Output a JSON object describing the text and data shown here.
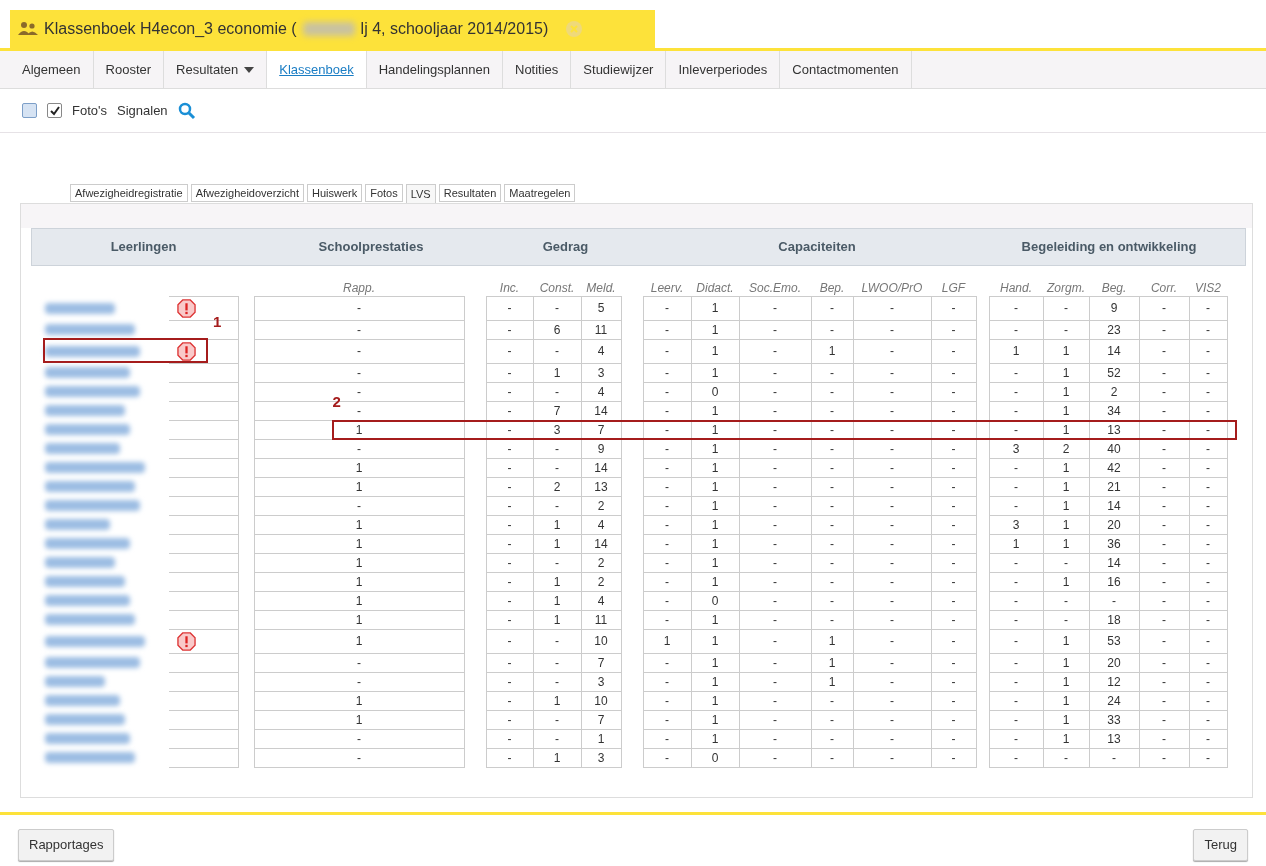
{
  "window": {
    "title_start": "Klassenboek H4econ_3 economie (",
    "title_end": "lj 4, schooljaar 2014/2015)"
  },
  "nav_tabs": [
    {
      "label": "Algemeen",
      "selected": false,
      "dropdown": false
    },
    {
      "label": "Rooster",
      "selected": false,
      "dropdown": false
    },
    {
      "label": "Resultaten",
      "selected": false,
      "dropdown": true
    },
    {
      "label": "Klassenboek",
      "selected": true,
      "dropdown": false
    },
    {
      "label": "Handelingsplannen",
      "selected": false,
      "dropdown": false
    },
    {
      "label": "Notities",
      "selected": false,
      "dropdown": false
    },
    {
      "label": "Studiewijzer",
      "selected": false,
      "dropdown": false
    },
    {
      "label": "Inleverperiodes",
      "selected": false,
      "dropdown": false
    },
    {
      "label": "Contactmomenten",
      "selected": false,
      "dropdown": false
    }
  ],
  "toolbar": {
    "checkboxes": [
      {
        "checked": false
      },
      {
        "checked": true
      }
    ],
    "labels": [
      "Foto's",
      "Signalen"
    ]
  },
  "sub_tabs": [
    {
      "label": "Afwezigheidregistratie",
      "selected": false
    },
    {
      "label": "Afwezigheidoverzicht",
      "selected": false
    },
    {
      "label": "Huiswerk",
      "selected": false
    },
    {
      "label": "Fotos",
      "selected": false
    },
    {
      "label": "LVS",
      "selected": true
    },
    {
      "label": "Resultaten",
      "selected": false
    },
    {
      "label": "Maatregelen",
      "selected": false
    }
  ],
  "table": {
    "groups": [
      "Leerlingen",
      "Schoolprestaties",
      "Gedrag",
      "Capaciteiten",
      "Begeleiding en ontwikkeling"
    ],
    "columns": [
      "Rapp.",
      "Inc.",
      "Const.",
      "Meld.",
      "Leerv.",
      "Didact.",
      "Soc.Emo.",
      "Bep.",
      "LWOO/PrO",
      "LGF",
      "Hand.",
      "Zorgm.",
      "Beg.",
      "Corr.",
      "VIS2"
    ],
    "rows": [
      {
        "alert": true,
        "cells": [
          "-",
          "-",
          "-",
          "5",
          "-",
          "1",
          "-",
          "-",
          "-",
          "-",
          "-",
          "-",
          "9",
          "-",
          "-"
        ]
      },
      {
        "alert": false,
        "cells": [
          "-",
          "-",
          "6",
          "11",
          "-",
          "1",
          "-",
          "-",
          "-",
          "-",
          "-",
          "-",
          "23",
          "-",
          "-"
        ]
      },
      {
        "alert": true,
        "name_annotation": "1",
        "cells": [
          "-",
          "-",
          "-",
          "4",
          "-",
          "1",
          "-",
          "1",
          "-",
          "-",
          "1",
          "1",
          "14",
          "-",
          "-"
        ]
      },
      {
        "alert": false,
        "cells": [
          "-",
          "-",
          "1",
          "3",
          "-",
          "1",
          "-",
          "-",
          "-",
          "-",
          "-",
          "1",
          "52",
          "-",
          "-"
        ]
      },
      {
        "alert": false,
        "cells": [
          "-",
          "-",
          "-",
          "4",
          "-",
          "0",
          "-",
          "-",
          "-",
          "-",
          "-",
          "1",
          "2",
          "-",
          "-"
        ]
      },
      {
        "alert": false,
        "cells": [
          "-",
          "-",
          "7",
          "14",
          "-",
          "1",
          "-",
          "-",
          "-",
          "-",
          "-",
          "1",
          "34",
          "-",
          "-"
        ]
      },
      {
        "alert": false,
        "data_annotation": "2",
        "cells": [
          "1",
          "-",
          "3",
          "7",
          "-",
          "1",
          "-",
          "-",
          "-",
          "-",
          "-",
          "1",
          "13",
          "-",
          "-"
        ]
      },
      {
        "alert": false,
        "cells": [
          "-",
          "-",
          "-",
          "9",
          "-",
          "1",
          "-",
          "-",
          "-",
          "-",
          "3",
          "2",
          "40",
          "-",
          "-"
        ]
      },
      {
        "alert": false,
        "cells": [
          "1",
          "-",
          "-",
          "14",
          "-",
          "1",
          "-",
          "-",
          "-",
          "-",
          "-",
          "1",
          "42",
          "-",
          "-"
        ]
      },
      {
        "alert": false,
        "cells": [
          "1",
          "-",
          "2",
          "13",
          "-",
          "1",
          "-",
          "-",
          "-",
          "-",
          "-",
          "1",
          "21",
          "-",
          "-"
        ]
      },
      {
        "alert": false,
        "cells": [
          "-",
          "-",
          "-",
          "2",
          "-",
          "1",
          "-",
          "-",
          "-",
          "-",
          "-",
          "1",
          "14",
          "-",
          "-"
        ]
      },
      {
        "alert": false,
        "cells": [
          "1",
          "-",
          "1",
          "4",
          "-",
          "1",
          "-",
          "-",
          "-",
          "-",
          "3",
          "1",
          "20",
          "-",
          "-"
        ]
      },
      {
        "alert": false,
        "cells": [
          "1",
          "-",
          "1",
          "14",
          "-",
          "1",
          "-",
          "-",
          "-",
          "-",
          "1",
          "1",
          "36",
          "-",
          "-"
        ]
      },
      {
        "alert": false,
        "cells": [
          "1",
          "-",
          "-",
          "2",
          "-",
          "1",
          "-",
          "-",
          "-",
          "-",
          "-",
          "-",
          "14",
          "-",
          "-"
        ]
      },
      {
        "alert": false,
        "cells": [
          "1",
          "-",
          "1",
          "2",
          "-",
          "1",
          "-",
          "-",
          "-",
          "-",
          "-",
          "1",
          "16",
          "-",
          "-"
        ]
      },
      {
        "alert": false,
        "cells": [
          "1",
          "-",
          "1",
          "4",
          "-",
          "0",
          "-",
          "-",
          "-",
          "-",
          "-",
          "-",
          "-",
          "-",
          "-"
        ]
      },
      {
        "alert": false,
        "cells": [
          "1",
          "-",
          "1",
          "11",
          "-",
          "1",
          "-",
          "-",
          "-",
          "-",
          "-",
          "-",
          "18",
          "-",
          "-"
        ]
      },
      {
        "alert": true,
        "cells": [
          "1",
          "-",
          "-",
          "10",
          "1",
          "1",
          "-",
          "1",
          "-",
          "-",
          "-",
          "1",
          "53",
          "-",
          "-"
        ]
      },
      {
        "alert": false,
        "cells": [
          "-",
          "-",
          "-",
          "7",
          "-",
          "1",
          "-",
          "1",
          "-",
          "-",
          "-",
          "1",
          "20",
          "-",
          "-"
        ]
      },
      {
        "alert": false,
        "cells": [
          "-",
          "-",
          "-",
          "3",
          "-",
          "1",
          "-",
          "1",
          "-",
          "-",
          "-",
          "1",
          "12",
          "-",
          "-"
        ]
      },
      {
        "alert": false,
        "cells": [
          "1",
          "-",
          "1",
          "10",
          "-",
          "1",
          "-",
          "-",
          "-",
          "-",
          "-",
          "1",
          "24",
          "-",
          "-"
        ]
      },
      {
        "alert": false,
        "cells": [
          "1",
          "-",
          "-",
          "7",
          "-",
          "1",
          "-",
          "-",
          "-",
          "-",
          "-",
          "1",
          "33",
          "-",
          "-"
        ]
      },
      {
        "alert": false,
        "cells": [
          "-",
          "-",
          "-",
          "1",
          "-",
          "1",
          "-",
          "-",
          "-",
          "-",
          "-",
          "1",
          "13",
          "-",
          "-"
        ]
      },
      {
        "alert": false,
        "cells": [
          "-",
          "-",
          "1",
          "3",
          "-",
          "0",
          "-",
          "-",
          "-",
          "-",
          "-",
          "-",
          "-",
          "-",
          "-"
        ]
      }
    ]
  },
  "footer": {
    "buttons": [
      {
        "label": "Rapportages"
      },
      {
        "label": "Terug"
      }
    ]
  }
}
